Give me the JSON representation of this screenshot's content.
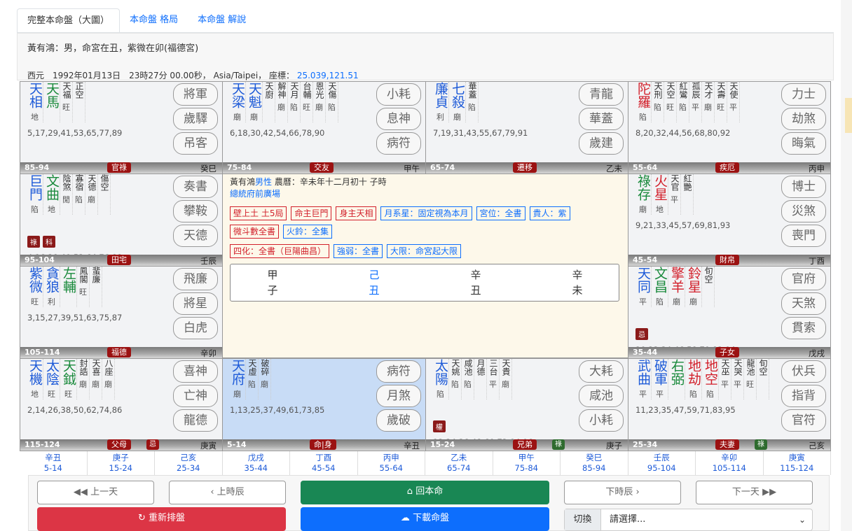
{
  "tabs": [
    "完整本命盤（大圖）",
    "本命盤 格局",
    "本命盤 解說"
  ],
  "header": {
    "line1": "黃有鴻：男，命宮在丑，紫微在卯(福德宮)",
    "line2": "西元　1992年01月13日　23時27分 00.00秒， Asia/Taipei， 座標：",
    "coords": "25.039,121.51"
  },
  "cells": [
    {
      "id": "si",
      "stars": [
        {
          "n": "天相",
          "c": "blue",
          "b": "地"
        },
        {
          "n": "天馬",
          "c": "green",
          "b": ""
        },
        {
          "n": "天福",
          "c": "small",
          "b": "旺"
        },
        {
          "n": "正空",
          "c": "small",
          "b": ""
        }
      ],
      "badges": [],
      "ages": "5,17,29,41,53,65,77,89",
      "gods": [
        "將軍",
        "歲驛",
        "吊客"
      ],
      "range": "85-94",
      "palace": "官祿",
      "ganzhi": "癸巳"
    },
    {
      "id": "wu",
      "stars": [
        {
          "n": "天梁",
          "c": "blue",
          "b": "廟"
        },
        {
          "n": "天魁",
          "c": "blue",
          "b": "廟"
        },
        {
          "n": "天廚",
          "c": "small",
          "b": ""
        },
        {
          "n": "解神",
          "c": "small",
          "b": "廟"
        },
        {
          "n": "天月",
          "c": "small",
          "b": "陷"
        },
        {
          "n": "台輔",
          "c": "small",
          "b": "旺"
        },
        {
          "n": "恩光",
          "c": "small",
          "b": "廟"
        },
        {
          "n": "天傷",
          "c": "small",
          "b": "陷"
        }
      ],
      "badges": [],
      "ages": "6,18,30,42,54,66,78,90",
      "gods": [
        "小耗",
        "息神",
        "病符"
      ],
      "range": "75-84",
      "palace": "交友",
      "ganzhi": "甲午"
    },
    {
      "id": "wei",
      "stars": [
        {
          "n": "廉貞",
          "c": "blue",
          "b": "利"
        },
        {
          "n": "七殺",
          "c": "blue",
          "b": "廟"
        },
        {
          "n": "華蓋",
          "c": "small",
          "b": "陷"
        }
      ],
      "badges": [],
      "ages": "7,19,31,43,55,67,79,91",
      "gods": [
        "青龍",
        "華蓋",
        "歲建"
      ],
      "range": "65-74",
      "palace": "遷移",
      "ganzhi": "乙未"
    },
    {
      "id": "shen",
      "stars": [
        {
          "n": "陀羅",
          "c": "red",
          "b": "陷"
        },
        {
          "n": "天刑",
          "c": "small",
          "b": "陷"
        },
        {
          "n": "天空",
          "c": "small",
          "b": "旺"
        },
        {
          "n": "紅鸞",
          "c": "small",
          "b": "陷"
        },
        {
          "n": "孤辰",
          "c": "small",
          "b": "平"
        },
        {
          "n": "天才",
          "c": "small",
          "b": "廟"
        },
        {
          "n": "天壽",
          "c": "small",
          "b": "旺"
        },
        {
          "n": "天使",
          "c": "small",
          "b": "平"
        }
      ],
      "badges": [],
      "ages": "8,20,32,44,56,68,80,92",
      "gods": [
        "力士",
        "劫煞",
        "晦氣"
      ],
      "range": "55-64",
      "palace": "疾厄",
      "ganzhi": "丙申"
    },
    {
      "id": "chen",
      "stars": [
        {
          "n": "巨門",
          "c": "blue",
          "b": "陷"
        },
        {
          "n": "文曲",
          "c": "green",
          "b": "地"
        },
        {
          "n": "陰煞",
          "c": "small",
          "b": "閒"
        },
        {
          "n": "寡宿",
          "c": "small",
          "b": "陷"
        },
        {
          "n": "天德",
          "c": "small",
          "b": "廟"
        },
        {
          "n": "傷空",
          "c": "small",
          "b": ""
        }
      ],
      "badges": [
        {
          "t": "祿",
          "c": "red"
        },
        {
          "t": "科",
          "c": "red"
        }
      ],
      "ages": "4,16,28,40,52,64,76,88",
      "gods": [
        "奏書",
        "攀鞍",
        "天德"
      ],
      "range": "95-104",
      "palace": "田宅",
      "ganzhi": "壬辰"
    },
    {
      "id": "you",
      "stars": [
        {
          "n": "祿存",
          "c": "green",
          "b": "廟"
        },
        {
          "n": "火星",
          "c": "red",
          "b": "地"
        },
        {
          "n": "天官",
          "c": "small",
          "b": "平"
        },
        {
          "n": "紅艷",
          "c": "small",
          "b": ""
        }
      ],
      "badges": [],
      "ages": "9,21,33,45,57,69,81,93",
      "gods": [
        "博士",
        "災煞",
        "喪門"
      ],
      "range": "45-54",
      "palace": "財帛",
      "ganzhi": "丁酉"
    },
    {
      "id": "mao",
      "stars": [
        {
          "n": "紫微",
          "c": "blue",
          "b": "旺"
        },
        {
          "n": "貪狼",
          "c": "blue",
          "b": "利"
        },
        {
          "n": "左輔",
          "c": "green",
          "b": ""
        },
        {
          "n": "鳳閣",
          "c": "small",
          "b": "旺"
        },
        {
          "n": "蜚廉",
          "c": "small",
          "b": ""
        }
      ],
      "badges": [],
      "ages": "3,15,27,39,51,63,75,87",
      "gods": [
        "飛廉",
        "將星",
        "白虎"
      ],
      "range": "105-114",
      "palace": "福德",
      "ganzhi": "辛卯"
    },
    {
      "id": "xu",
      "stars": [
        {
          "n": "天同",
          "c": "blue",
          "b": "平"
        },
        {
          "n": "文昌",
          "c": "green",
          "b": "陷"
        },
        {
          "n": "擎羊",
          "c": "red",
          "b": "廟"
        },
        {
          "n": "鈴星",
          "c": "red",
          "b": "廟"
        },
        {
          "n": "旬空",
          "c": "small",
          "b": ""
        }
      ],
      "badges": [
        {
          "t": "忌",
          "c": "red"
        }
      ],
      "ages": "10,22,34,46,58,70,82,94",
      "gods": [
        "官府",
        "天煞",
        "貫索"
      ],
      "range": "35-44",
      "palace": "子女",
      "ganzhi": "戊戌"
    },
    {
      "id": "yin",
      "stars": [
        {
          "n": "天機",
          "c": "blue",
          "b": "地"
        },
        {
          "n": "太陰",
          "c": "blue",
          "b": "旺"
        },
        {
          "n": "天鉞",
          "c": "green",
          "b": "旺"
        },
        {
          "n": "封誥",
          "c": "small",
          "b": "廟"
        },
        {
          "n": "天喜",
          "c": "small",
          "b": "廟"
        },
        {
          "n": "八座",
          "c": "small",
          "b": "廟"
        }
      ],
      "badges": [],
      "ages": "2,14,26,38,50,62,74,86",
      "gods": [
        "喜神",
        "亡神",
        "龍德"
      ],
      "range": "115-124",
      "palace": "父母",
      "palace2": "忌",
      "ganzhi": "庚寅"
    },
    {
      "id": "chou",
      "stars": [
        {
          "n": "天府",
          "c": "blue",
          "b": "廟"
        },
        {
          "n": "天虛",
          "c": "small",
          "b": "陷"
        },
        {
          "n": "破碎",
          "c": "small",
          "b": "廟"
        }
      ],
      "badges": [],
      "ages": "1,13,25,37,49,61,73,85",
      "gods": [
        "病符",
        "月煞",
        "歲破"
      ],
      "range": "5-14",
      "palace": "命|身",
      "ganzhi": "辛丑",
      "ming": true
    },
    {
      "id": "zi",
      "stars": [
        {
          "n": "太陽",
          "c": "blue",
          "b": "陷"
        },
        {
          "n": "天姚",
          "c": "small",
          "b": "陷"
        },
        {
          "n": "咸池",
          "c": "small",
          "b": "陷"
        },
        {
          "n": "月德",
          "c": "small",
          "b": ""
        },
        {
          "n": "三台",
          "c": "small",
          "b": "平"
        },
        {
          "n": "天貴",
          "c": "small",
          "b": "廟"
        }
      ],
      "badges": [
        {
          "t": "權",
          "c": "red"
        }
      ],
      "ages": "12,24,36,48,60,72,84,96",
      "gods": [
        "大耗",
        "咸池",
        "小耗"
      ],
      "range": "15-24",
      "palace": "兄弟",
      "palace2": "祿",
      "ganzhi": "庚子"
    },
    {
      "id": "hai",
      "stars": [
        {
          "n": "武曲",
          "c": "blue",
          "b": "平"
        },
        {
          "n": "破軍",
          "c": "blue",
          "b": "平"
        },
        {
          "n": "右弼",
          "c": "green",
          "b": ""
        },
        {
          "n": "地劫",
          "c": "red",
          "b": "陷"
        },
        {
          "n": "地空",
          "c": "red",
          "b": "陷"
        },
        {
          "n": "天巫",
          "c": "small",
          "b": "平"
        },
        {
          "n": "天哭",
          "c": "small",
          "b": "平"
        },
        {
          "n": "龍池",
          "c": "small",
          "b": "旺"
        },
        {
          "n": "旬空",
          "c": "small",
          "b": ""
        }
      ],
      "badges": [],
      "ages": "11,23,35,47,59,71,83,95",
      "gods": [
        "伏兵",
        "指背",
        "官符"
      ],
      "range": "25-34",
      "palace": "夫妻",
      "palace2": "祿",
      "ganzhi": "己亥"
    }
  ],
  "center": {
    "name": "黃有鴻",
    "gender": "男性",
    "lunar": " 農曆：辛未年十二月初十 子時",
    "place": "總統府前廣場",
    "row1": [
      {
        "t": "壁上土 土5局",
        "c": "r"
      },
      {
        "t": "命主巨門",
        "c": "r"
      },
      {
        "t": "身主天相",
        "c": "r"
      },
      {
        "t": "月系星：固定視為本月",
        "c": "b"
      },
      {
        "t": "宮位：全書",
        "c": "b"
      },
      {
        "t": "貴人：紫",
        "c": "b"
      }
    ],
    "row2": [
      {
        "t": "微斗數全書",
        "c": "r"
      },
      {
        "t": "火鈴：全集",
        "c": "b"
      }
    ],
    "row3": [
      {
        "t": "四化：全書（巨陽曲昌）",
        "c": "r"
      },
      {
        "t": "強弱：全書",
        "c": "b"
      },
      {
        "t": "大限：命宮起大限",
        "c": "b"
      }
    ],
    "pillars": [
      [
        "甲",
        "子"
      ],
      [
        "己",
        "丑"
      ],
      [
        "辛",
        "丑"
      ],
      [
        "辛",
        "未"
      ]
    ]
  },
  "bottom": [
    [
      "辛丑",
      "5-14"
    ],
    [
      "庚子",
      "15-24"
    ],
    [
      "己亥",
      "25-34"
    ],
    [
      "戊戌",
      "35-44"
    ],
    [
      "丁酉",
      "45-54"
    ],
    [
      "丙申",
      "55-64"
    ],
    [
      "乙未",
      "65-74"
    ],
    [
      "甲午",
      "75-84"
    ],
    [
      "癸巳",
      "85-94"
    ],
    [
      "壬辰",
      "95-104"
    ],
    [
      "辛卯",
      "105-114"
    ],
    [
      "庚寅",
      "115-124"
    ]
  ],
  "buttons": {
    "prev_day": "上一天",
    "prev_hour": "上時辰",
    "home": "回本命",
    "next_hour": "下時辰",
    "next_day": "下一天",
    "reset": "重新排盤",
    "download": "下載命盤",
    "switch": "切換",
    "select": "請選擇..."
  }
}
